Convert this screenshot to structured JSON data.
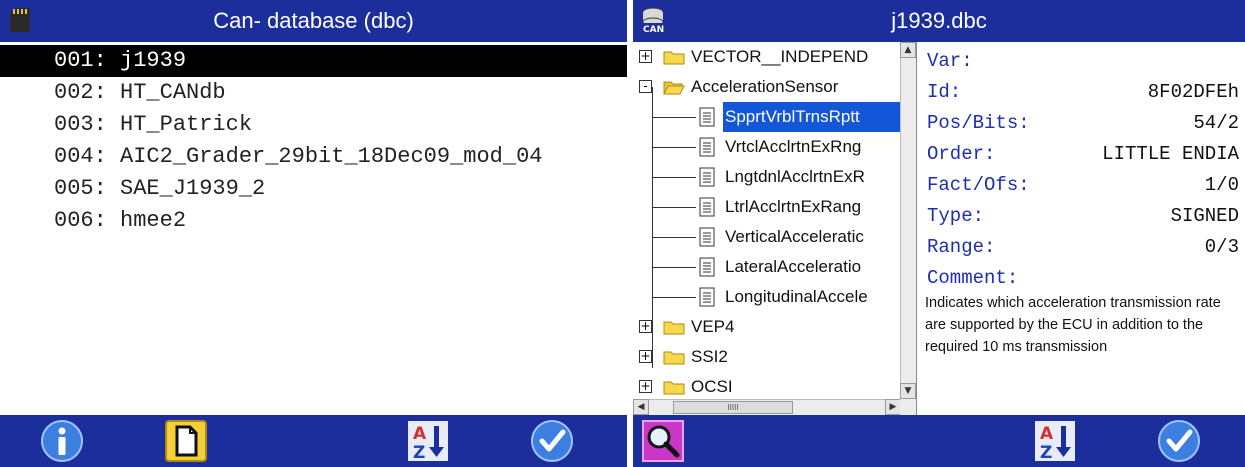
{
  "left_panel": {
    "title": "Can- database (dbc)",
    "items": [
      {
        "label": "001: j1939",
        "selected": true
      },
      {
        "label": "002: HT_CANdb",
        "selected": false
      },
      {
        "label": "003: HT_Patrick",
        "selected": false
      },
      {
        "label": "004: AIC2_Grader_29bit_18Dec09_mod_04",
        "selected": false
      },
      {
        "label": "005: SAE_J1939_2",
        "selected": false
      },
      {
        "label": "006: hmee2",
        "selected": false
      }
    ],
    "toolbar": [
      "info-icon",
      "document-icon",
      "sort-az-icon",
      "confirm-check-icon"
    ]
  },
  "right_panel": {
    "title": "j1939.dbc",
    "title_icon_text": "CAN",
    "tree": {
      "nodes": [
        {
          "label": "VECTOR__INDEPEND",
          "type": "folder",
          "expander": "+"
        },
        {
          "label": "AccelerationSensor",
          "type": "folder-open",
          "expander": "-"
        },
        {
          "label": "SpprtVrblTrnsRptt",
          "type": "signal",
          "selected": true
        },
        {
          "label": "VrtclAcclrtnExRng",
          "type": "signal"
        },
        {
          "label": "LngtdnlAcclrtnExR",
          "type": "signal"
        },
        {
          "label": "LtrlAcclrtnExRang",
          "type": "signal"
        },
        {
          "label": "VerticalAcceleratic",
          "type": "signal"
        },
        {
          "label": "LateralAcceleratio",
          "type": "signal"
        },
        {
          "label": "LongitudinalAccele",
          "type": "signal"
        },
        {
          "label": "VEP4",
          "type": "folder",
          "expander": "+"
        },
        {
          "label": "SSI2",
          "type": "folder",
          "expander": "+"
        },
        {
          "label": "OCSI",
          "type": "folder",
          "expander": "+"
        }
      ],
      "hscroll_thumb": "IIIII"
    },
    "properties": {
      "var_label": "Var:",
      "id_label": "Id:",
      "id_value": "8F02DFEh",
      "posbits_label": "Pos/Bits:",
      "posbits_value": "54/2",
      "order_label": "Order:",
      "order_value": "LITTLE ENDIA",
      "factofs_label": "Fact/Ofs:",
      "factofs_value": "1/0",
      "type_label": "Type:",
      "type_value": "SIGNED",
      "range_label": "Range:",
      "range_value": "0/3",
      "comment_label": "Comment:",
      "comment_text": "Indicates which acceleration transmission rate are supported by the ECU in addition to the required 10 ms transmission"
    },
    "toolbar": [
      "magnifier-icon",
      "sort-az-icon",
      "confirm-check-icon"
    ]
  },
  "colors": {
    "bar": "#1c2e9c",
    "selection": "#1456d8",
    "key_text": "#1c2fb0",
    "list_selected": "#000000"
  }
}
